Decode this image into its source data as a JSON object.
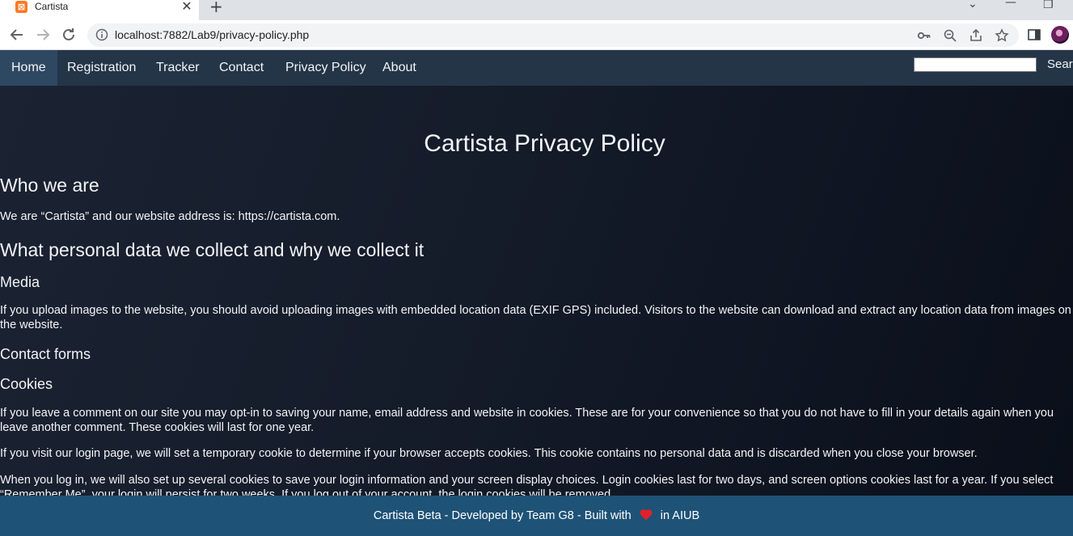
{
  "browser": {
    "tab_title": "Cartista",
    "favicon_letter": "⊠",
    "url": "localhost:7882/Lab9/privacy-policy.php"
  },
  "nav": {
    "items": [
      {
        "label": "Home",
        "active": true
      },
      {
        "label": "Registration",
        "active": false
      },
      {
        "label": "Tracker",
        "active": false
      },
      {
        "label": "Contact",
        "active": false
      },
      {
        "label": "Privacy Policy",
        "active": false
      },
      {
        "label": "About",
        "active": false
      }
    ],
    "search_label": "Searc"
  },
  "page": {
    "title": "Cartista Privacy Policy",
    "sections": {
      "who_we_are": "Who we are",
      "who_we_are_text": "We are “Cartista” and our website address is: https://cartista.com.",
      "personal_data": "What personal data we collect and why we collect it",
      "media": "Media",
      "media_text": "If you upload images to the website, you should avoid uploading images with embedded location data (EXIF GPS) included. Visitors to the website can download and extract any location data from images on the website.",
      "contact_forms": "Contact forms",
      "cookies": "Cookies",
      "cookies_text_1": "If you leave a comment on our site you may opt-in to saving your name, email address and website in cookies. These are for your convenience so that you do not have to fill in your details again when you leave another comment. These cookies will last for one year.",
      "cookies_text_2": "If you visit our login page, we will set a temporary cookie to determine if your browser accepts cookies. This cookie contains no personal data and is discarded when you close your browser.",
      "cookies_text_3": "When you log in, we will also set up several cookies to save your login information and your screen display choices. Login cookies last for two days, and screen options cookies last for a year. If you select “Remember Me”, your login will persist for two weeks. If you log out of your account, the login cookies will be removed."
    }
  },
  "footer": {
    "text_before": "Cartista Beta - Developed by Team G8 - Built with",
    "text_after": "in AIUB"
  },
  "colors": {
    "nav_bg": "#243548",
    "footer_bg": "#1e5277",
    "content_bg": "#141b29",
    "heart": "#e0212b"
  }
}
